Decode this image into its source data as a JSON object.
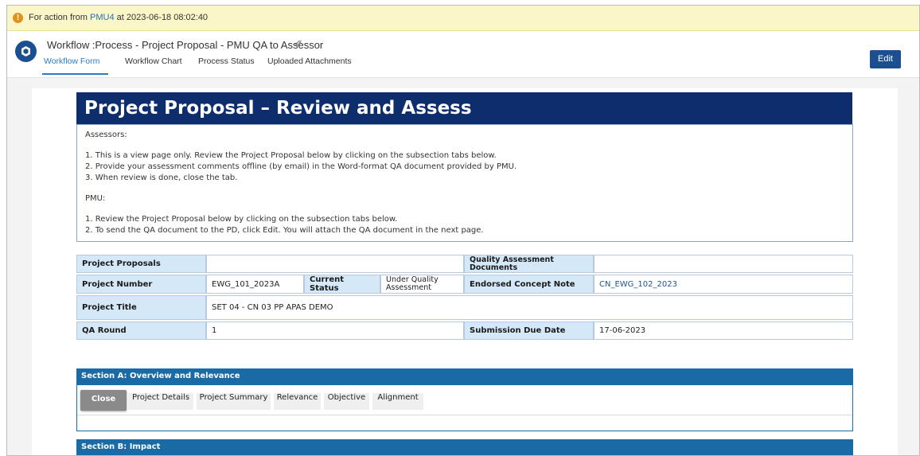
{
  "notice": {
    "icon": "warning-icon",
    "prefix": "For action from",
    "from": "PMU4",
    "at_label": "at",
    "timestamp": "2023-06-18 08:02:40"
  },
  "header": {
    "title": "Workflow :Process - Project Proposal - PMU QA to Assessor",
    "edit_label": "Edit",
    "tabs": [
      {
        "label": "Workflow Form",
        "active": true
      },
      {
        "label": "Workflow Chart",
        "active": false
      },
      {
        "label": "Process Status",
        "active": false
      },
      {
        "label": "Uploaded Attachments",
        "active": false
      }
    ]
  },
  "form": {
    "banner": "Project Proposal – Review and Assess",
    "instructions": {
      "assessors_heading": "Assessors:",
      "assessors_items": [
        "1. This is a view page only. Review the Project Proposal below by clicking on the subsection tabs below.",
        "2. Provide your assessment comments offline (by email) in the Word-format QA document provided by PMU.",
        "3. When review is done, close the tab."
      ],
      "pmu_heading": "PMU:",
      "pmu_items": [
        "1. Review the Project Proposal below by clicking on the subsection tabs below.",
        "2. To send the QA document to the PD, click Edit. You will attach the QA document in the next page."
      ]
    },
    "info": {
      "project_proposals_label": "Project Proposals",
      "project_proposals_value": "",
      "qa_documents_label": "Quality Assessment Documents",
      "qa_documents_value": "",
      "project_number_label": "Project Number",
      "project_number_value": "EWG_101_2023A",
      "current_status_label": "Current Status",
      "current_status_value": "Under Quality Assessment",
      "endorsed_note_label": "Endorsed Concept Note",
      "endorsed_note_value": "CN_EWG_102_2023",
      "project_title_label": "Project Title",
      "project_title_value": "SET 04 - CN 03 PP APAS DEMO",
      "qa_round_label": "QA Round",
      "qa_round_value": "1",
      "due_date_label": "Submission Due Date",
      "due_date_value": "17-06-2023"
    },
    "section_a": {
      "title": "Section A: Overview and Relevance",
      "close_label": "Close",
      "tabs": [
        "Project Details",
        "Project Summary",
        "Relevance",
        "Objective",
        "Alignment"
      ]
    },
    "section_b": {
      "title": "Section B: Impact"
    }
  },
  "colors": {
    "banner": "#0e2d6c",
    "section_header": "#1a6aa6",
    "label_cell": "#d5e8f7",
    "notice_bg": "#fbf6c7",
    "accent": "#2d7cc1",
    "edit_button": "#1b4f8f"
  }
}
